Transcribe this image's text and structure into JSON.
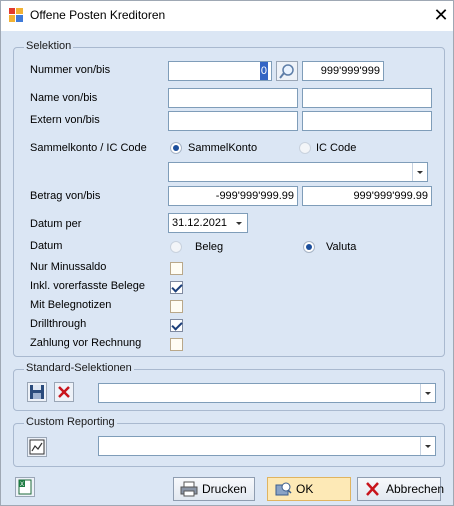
{
  "window": {
    "title": "Offene Posten Kreditoren"
  },
  "selektion": {
    "legend": "Selektion",
    "nummer": {
      "label": "Nummer von/bis",
      "von": "0",
      "bis": "999'999'999"
    },
    "name": {
      "label": "Name von/bis",
      "von": "",
      "bis": ""
    },
    "extern": {
      "label": "Extern von/bis",
      "von": "",
      "bis": ""
    },
    "sammelkonto": {
      "label": "Sammelkonto / IC Code",
      "option1": "SammelKonto",
      "option2": "IC Code",
      "selected": "SammelKonto",
      "combo_value": ""
    },
    "betrag": {
      "label": "Betrag von/bis",
      "von": "-999'999'999.99",
      "bis": "999'999'999.99"
    },
    "datum_per": {
      "label": "Datum per",
      "value": "31.12.2021"
    },
    "datum": {
      "label": "Datum",
      "option1": "Beleg",
      "option2": "Valuta",
      "selected": "Valuta"
    },
    "checks": [
      {
        "label": "Nur Minussaldo",
        "checked": false
      },
      {
        "label": "Inkl. vorerfasste Belege",
        "checked": true
      },
      {
        "label": "Mit Belegnotizen",
        "checked": false
      },
      {
        "label": "Drillthrough",
        "checked": true
      },
      {
        "label": "Zahlung vor Rechnung",
        "checked": false
      }
    ]
  },
  "standard": {
    "legend": "Standard-Selektionen",
    "combo_value": ""
  },
  "custom": {
    "legend": "Custom Reporting",
    "combo_value": ""
  },
  "buttons": {
    "drucken": "Drucken",
    "ok": "OK",
    "abbrechen": "Abbrechen"
  },
  "colors": {
    "client_bg": "#dbe6f4",
    "ok_bg": "#fde9b6"
  },
  "icons": [
    "app-icon",
    "close-icon",
    "search-icon",
    "save-icon",
    "delete-icon",
    "report-icon",
    "excel-icon",
    "printer-icon",
    "ok-icon",
    "cancel-icon"
  ]
}
